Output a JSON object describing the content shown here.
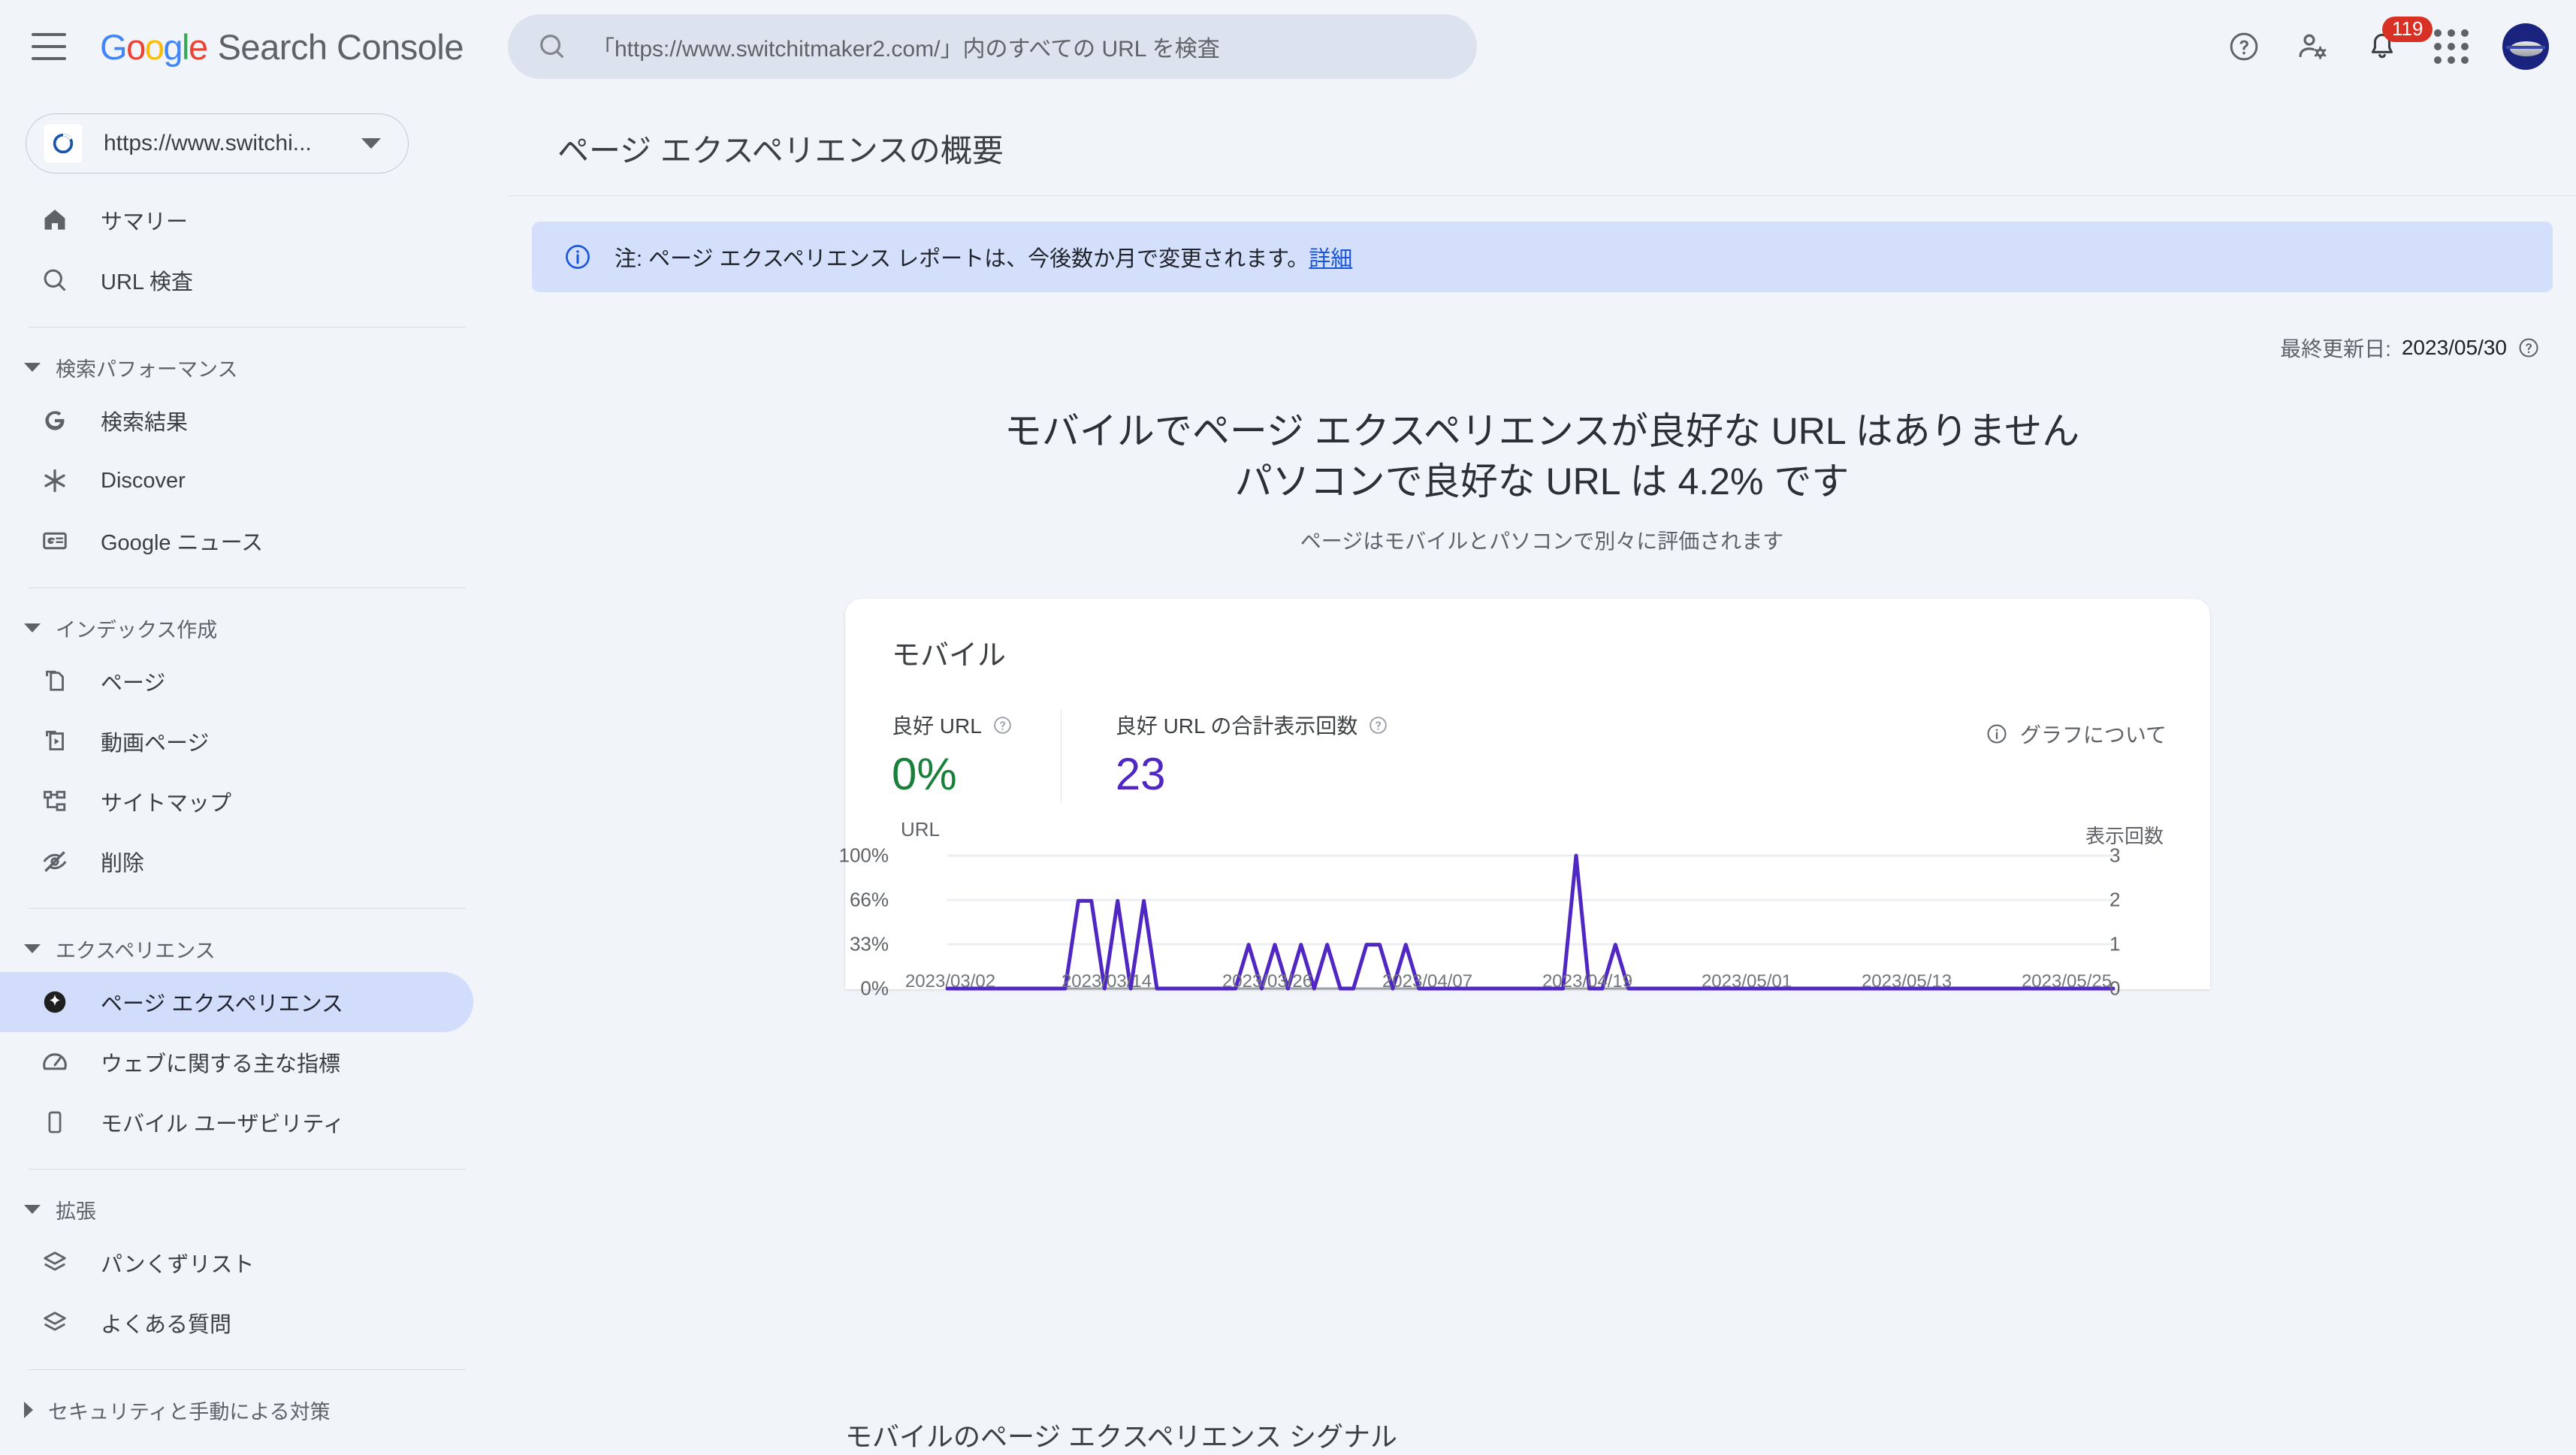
{
  "app": {
    "brand_google": "Google",
    "brand_product": "Search Console",
    "menu_icon": "hamburger-icon"
  },
  "search": {
    "placeholder": "「https://www.switchitmaker2.com/」内のすべての URL を検査",
    "icon": "search-icon"
  },
  "topbar_actions": {
    "help": "help-icon",
    "user_settings": "user-settings-icon",
    "notifications": "bell-icon",
    "notification_count": "119",
    "apps": "apps-grid-icon",
    "avatar": "avatar"
  },
  "sidebar": {
    "property": {
      "label": "https://www.switchi...",
      "favicon": "property-favicon",
      "caret": "chevron-down-icon"
    },
    "items": [
      {
        "label": "サマリー",
        "icon": "home-icon",
        "type": "item",
        "active": false
      },
      {
        "label": "URL 検査",
        "icon": "search-icon",
        "type": "item",
        "active": false
      },
      {
        "type": "separator"
      },
      {
        "label": "検索パフォーマンス",
        "type": "group",
        "expanded": true
      },
      {
        "label": "検索結果",
        "icon": "google-g-icon",
        "type": "item",
        "active": false
      },
      {
        "label": "Discover",
        "icon": "discover-asterisk-icon",
        "type": "item",
        "active": false
      },
      {
        "label": "Google ニュース",
        "icon": "news-card-icon",
        "type": "item",
        "active": false
      },
      {
        "type": "separator"
      },
      {
        "label": "インデックス作成",
        "type": "group",
        "expanded": true
      },
      {
        "label": "ページ",
        "icon": "pages-icon",
        "type": "item",
        "active": false
      },
      {
        "label": "動画ページ",
        "icon": "video-page-icon",
        "type": "item",
        "active": false
      },
      {
        "label": "サイトマップ",
        "icon": "sitemap-icon",
        "type": "item",
        "active": false
      },
      {
        "label": "削除",
        "icon": "eye-off-icon",
        "type": "item",
        "active": false
      },
      {
        "type": "separator"
      },
      {
        "label": "エクスペリエンス",
        "type": "group",
        "expanded": true
      },
      {
        "label": "ページ エクスペリエンス",
        "icon": "page-experience-icon",
        "type": "item",
        "active": true
      },
      {
        "label": "ウェブに関する主な指標",
        "icon": "speedometer-icon",
        "type": "item",
        "active": false
      },
      {
        "label": "モバイル ユーザビリティ",
        "icon": "mobile-icon",
        "type": "item",
        "active": false
      },
      {
        "type": "separator"
      },
      {
        "label": "拡張",
        "type": "group",
        "expanded": true
      },
      {
        "label": "パンくずリスト",
        "icon": "layers-icon",
        "type": "item",
        "active": false
      },
      {
        "label": "よくある質問",
        "icon": "layers-icon",
        "type": "item",
        "active": false
      },
      {
        "type": "separator"
      },
      {
        "label": "セキュリティと手動による対策",
        "type": "group",
        "expanded": false
      }
    ]
  },
  "main": {
    "page_title": "ページ エクスペリエンスの概要",
    "banner": {
      "icon": "info-icon",
      "text": "注: ページ エクスペリエンス レポートは、今後数か月で変更されます。",
      "link": "詳細"
    },
    "last_updated_label": "最終更新日:",
    "last_updated_date": "2023/05/30",
    "last_updated_help": "help-icon",
    "headline_line1": "モバイルでページ エクスペリエンスが良好な URL はありません",
    "headline_line2": "パソコンで良好な URL は 4.2% です",
    "subheadline": "ページはモバイルとパソコンで別々に評価されます",
    "card": {
      "title": "モバイル",
      "metrics": [
        {
          "label": "良好 URL",
          "help": "help-icon",
          "value": "0%",
          "color": "#188038"
        },
        {
          "label": "良好 URL の合計表示回数",
          "help": "help-icon",
          "value": "23",
          "color": "#5127c4"
        }
      ],
      "about_graph": "グラフについて",
      "about_graph_icon": "info-icon"
    },
    "section_title": "モバイルのページ エクスペリエンス シグナル"
  },
  "colors": {
    "page_bg": "#f1f4f9",
    "card_bg": "#ffffff",
    "accent_purple": "#5127c4",
    "good_green": "#188038",
    "banner_bg": "#d3dffb",
    "link_blue": "#1a56db",
    "active_nav_bg": "#d2dcfb",
    "badge_red": "#d93025"
  },
  "chart_data": {
    "type": "line",
    "title": "",
    "ylabel_left": "URL",
    "ylabel_right": "表示回数",
    "y_left_ticks": [
      "0%",
      "33%",
      "66%",
      "100%"
    ],
    "y_right_ticks": [
      "0",
      "1",
      "2",
      "3"
    ],
    "ylim_left": [
      0,
      100
    ],
    "ylim_right": [
      0,
      3
    ],
    "grid": true,
    "legend": "none",
    "x_tick_labels": [
      "2023/03/02",
      "2023/03/14",
      "2023/03/26",
      "2023/04/07",
      "2023/04/19",
      "2023/05/01",
      "2023/05/13",
      "2023/05/25"
    ],
    "x_start": "2023/03/02",
    "x_end": "2023/05/30",
    "series": [
      {
        "name": "良好 URL",
        "color": "#5127c4",
        "values": [
          0,
          0,
          0,
          0,
          0,
          0,
          0,
          0,
          0,
          0,
          66,
          66,
          0,
          66,
          0,
          66,
          0,
          0,
          0,
          0,
          0,
          0,
          0,
          33,
          0,
          33,
          0,
          33,
          0,
          33,
          0,
          0,
          33,
          33,
          0,
          33,
          0,
          0,
          0,
          0,
          0,
          0,
          0,
          0,
          0,
          0,
          0,
          0,
          100,
          0,
          0,
          33,
          0,
          0,
          0,
          0,
          0,
          0,
          0,
          0,
          0,
          0,
          0,
          0,
          0,
          0,
          0,
          0,
          0,
          0,
          0,
          0,
          0,
          0,
          0,
          0,
          0,
          0,
          0,
          0,
          0,
          0,
          0,
          0,
          0,
          0,
          0,
          0,
          0,
          0
        ]
      }
    ]
  }
}
